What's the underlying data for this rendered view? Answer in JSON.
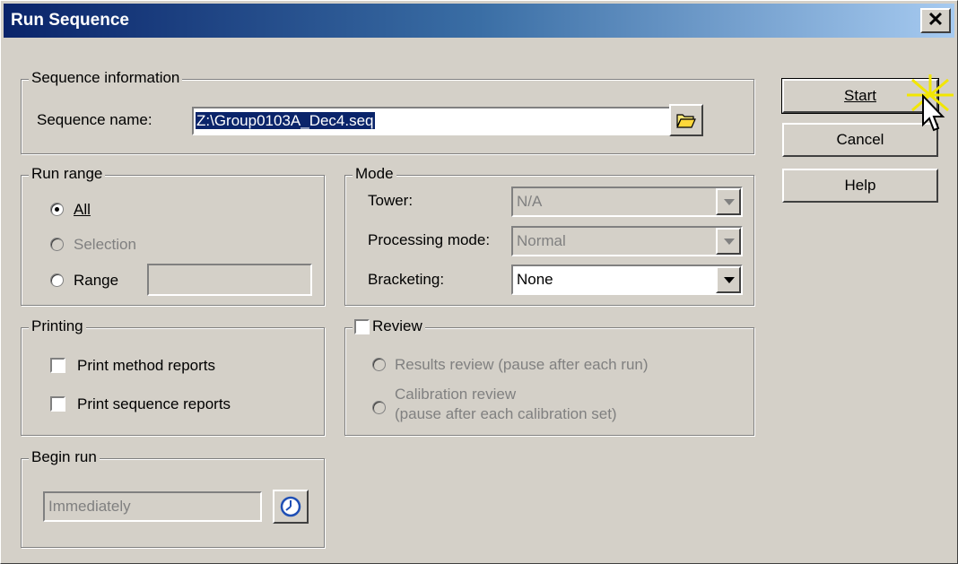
{
  "window": {
    "title": "Run Sequence",
    "close_label": "✕"
  },
  "sequence_info": {
    "legend": "Sequence information",
    "name_label": "Sequence name:",
    "name_value": "Z:\\Group0103A_Dec4.seq",
    "browse_icon": "folder-open-icon"
  },
  "run_range": {
    "legend": "Run range",
    "all_label": "All",
    "selection_label": "Selection",
    "range_label": "Range",
    "range_value": "",
    "selected": "All"
  },
  "mode": {
    "legend": "Mode",
    "tower_label": "Tower:",
    "tower_value": "N/A",
    "processing_label": "Processing mode:",
    "processing_value": "Normal",
    "bracketing_label": "Bracketing:",
    "bracketing_value": "None"
  },
  "printing": {
    "legend": "Printing",
    "method_label": "Print method reports",
    "sequence_label": "Print sequence reports"
  },
  "review": {
    "legend": "Review",
    "results_label": "Results review (pause after each run)",
    "calibration_label_line1": "Calibration review",
    "calibration_label_line2": "(pause after each calibration set)"
  },
  "begin_run": {
    "legend": "Begin run",
    "value": "Immediately",
    "clock_icon": "clock-icon"
  },
  "buttons": {
    "start": "Start",
    "cancel": "Cancel",
    "help": "Help"
  },
  "colors": {
    "title_start": "#0a246a",
    "title_end": "#a6caf0",
    "dialog_bg": "#d4d0c8",
    "selection_bg": "#0a246a"
  }
}
